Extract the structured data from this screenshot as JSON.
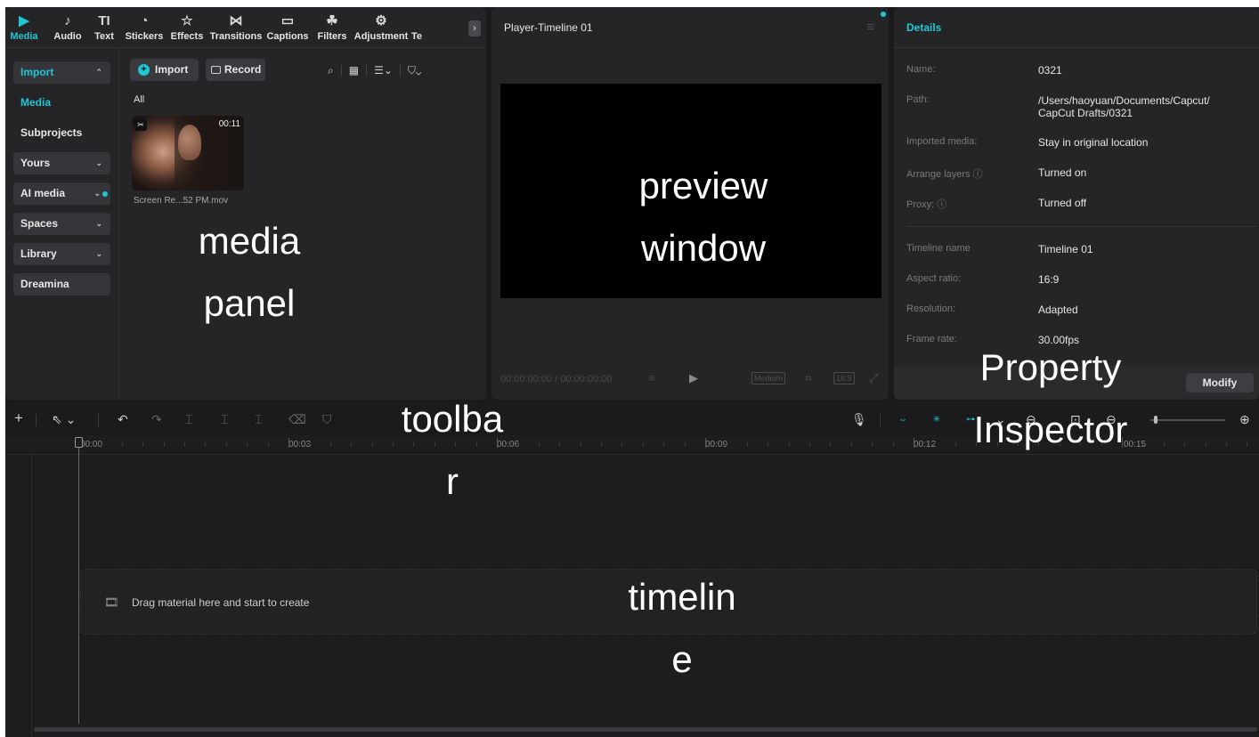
{
  "colors": {
    "accent": "#1fc7d6",
    "panel": "#252527",
    "background": "#1b1b1d"
  },
  "tool_tabs": [
    {
      "label": "Media",
      "icon": "media-play-icon",
      "glyph": "▶",
      "active": true
    },
    {
      "label": "Audio",
      "icon": "audio-icon",
      "glyph": "♪"
    },
    {
      "label": "Text",
      "icon": "text-icon",
      "glyph": "TI"
    },
    {
      "label": "Stickers",
      "icon": "stickers-icon",
      "glyph": "◔"
    },
    {
      "label": "Effects",
      "icon": "effects-icon",
      "glyph": "☆"
    },
    {
      "label": "Transitions",
      "icon": "transitions-icon",
      "glyph": "⋈"
    },
    {
      "label": "Captions",
      "icon": "captions-icon",
      "glyph": "▭"
    },
    {
      "label": "Filters",
      "icon": "filters-icon",
      "glyph": "☘"
    },
    {
      "label": "Adjustment",
      "icon": "adjustment-icon",
      "glyph": "⚙"
    },
    {
      "label": "Te",
      "icon": "template-icon",
      "glyph": ""
    }
  ],
  "sidebar": {
    "items": [
      {
        "label": "Import",
        "chevron": "⌃"
      },
      {
        "label": "Media"
      },
      {
        "label": "Subprojects"
      },
      {
        "label": "Yours",
        "chevron": "⌄"
      },
      {
        "label": "AI media",
        "chevron": "⌄"
      },
      {
        "label": "Spaces",
        "chevron": "⌄"
      },
      {
        "label": "Library",
        "chevron": "⌄"
      },
      {
        "label": "Dreamina"
      }
    ]
  },
  "media": {
    "import_label": "Import",
    "record_label": "Record",
    "filter_label": "All",
    "item": {
      "duration": "00:11",
      "name": "Screen Re...52 PM.mov"
    }
  },
  "preview": {
    "title": "Player-Timeline 01",
    "time_current": "00:00:00:00",
    "time_separator": "/",
    "time_total": "00:00:00:00",
    "quality": "Medium",
    "ratio": "16:9"
  },
  "details": {
    "title": "Details",
    "rows": [
      {
        "label": "Name:",
        "value": "0321"
      },
      {
        "label": "Path:",
        "value": "/Users/haoyuan/Documents/Capcut/ CapCut Drafts/0321"
      },
      {
        "label": "Imported media:",
        "value": "Stay in original location"
      },
      {
        "label": "Arrange layers ⓘ",
        "value": "Turned on"
      },
      {
        "label": "Proxy: ⓘ",
        "value": "Turned off"
      },
      {
        "label": "Timeline name",
        "value": "Timeline 01"
      },
      {
        "label": "Aspect ratio:",
        "value": "16:9"
      },
      {
        "label": "Resolution:",
        "value": "Adapted"
      },
      {
        "label": "Frame rate:",
        "value": "30.00fps"
      }
    ],
    "modify_label": "Modify"
  },
  "timeline": {
    "ticks": [
      "00:00",
      "00:03",
      "00:06",
      "00:09",
      "00:12",
      "00:15"
    ],
    "drop_text": "Drag material here and start to create"
  },
  "annotations": {
    "media_panel": "media\npanel",
    "preview_window": "preview\nwindow",
    "property_inspector": "Property\nInspector",
    "toolbar": "toolba\nr",
    "timeline": "timelin\ne"
  }
}
